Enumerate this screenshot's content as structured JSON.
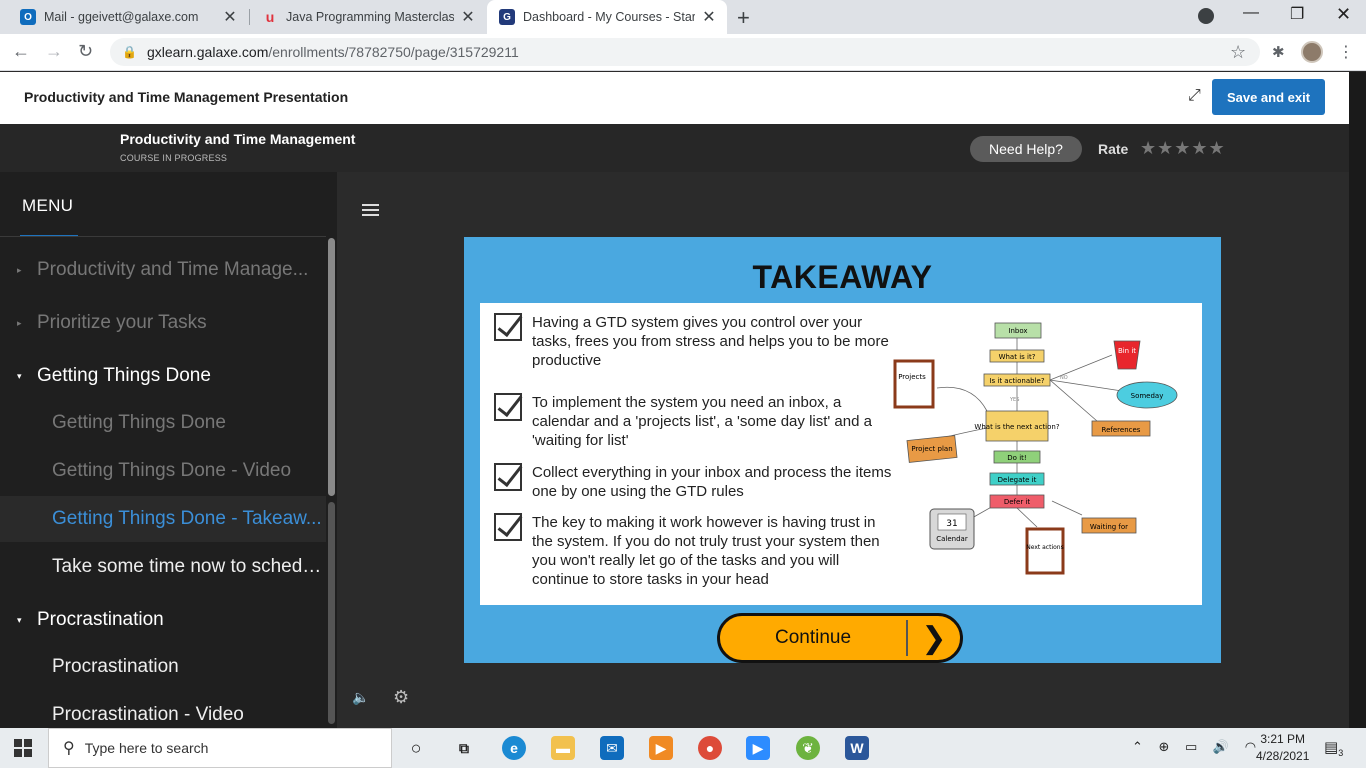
{
  "browser": {
    "tabs": [
      {
        "title": "Mail - ggeivett@galaxe.com",
        "icon": "outlook-icon",
        "icon_color": "#0f6cbd",
        "active": false
      },
      {
        "title": "Java Programming Masterclass fo",
        "icon": "udemy-icon",
        "icon_color": "#e0323d",
        "active": false
      },
      {
        "title": "Dashboard - My Courses - Start C",
        "icon": "galaxe-icon",
        "icon_color": "#223a7a",
        "active": true
      }
    ],
    "url_host": "gxlearn.galaxe.com",
    "url_path": "/enrollments/78782750/page/315729211"
  },
  "course_top": {
    "title": "Productivity and Time Management Presentation",
    "save_label": "Save and exit"
  },
  "banner": {
    "course_title": "Productivity and Time Management",
    "status": "COURSE IN PROGRESS",
    "help_label": "Need Help?",
    "rate_label": "Rate",
    "rating": 0,
    "stars": "★★★★★"
  },
  "sidebar": {
    "menu_label": "MENU",
    "items": [
      {
        "label": "Productivity and Time Manage...",
        "level": 0,
        "expanded": false,
        "dim": true
      },
      {
        "label": "Prioritize your Tasks",
        "level": 0,
        "expanded": false,
        "dim": true
      },
      {
        "label": "Getting Things Done",
        "level": 0,
        "expanded": true,
        "dim": false
      },
      {
        "label": "Getting Things Done",
        "level": 1,
        "dim": true
      },
      {
        "label": "Getting Things Done - Video",
        "level": 1,
        "dim": true
      },
      {
        "label": "Getting Things Done - Takeaw...",
        "level": 1,
        "active": true
      },
      {
        "label": "Take some time now to schedu...",
        "level": 1,
        "dim": false
      },
      {
        "label": "Procrastination",
        "level": 0,
        "expanded": true,
        "dim": false
      },
      {
        "label": "Procrastination",
        "level": 1,
        "dim": false
      },
      {
        "label": "Procrastination - Video",
        "level": 1,
        "dim": false
      }
    ]
  },
  "slide": {
    "title": "TAKEAWAY",
    "points": [
      "Having a GTD system gives you control over your tasks, frees you from stress and helps you to be more productive",
      "To implement the system you need an inbox, a calendar and a 'projects list', a 'some day list' and a 'waiting for list'",
      "Collect everything in your inbox and process the items one by one using the GTD rules",
      "The key to making it work however is having trust in the system. If you do not truly trust your system then you won't really let go of the tasks and you will continue to store tasks in your head"
    ],
    "diagram": {
      "inbox": "Inbox",
      "what": "What is it?",
      "actionable": "Is it actionable?",
      "no": "NO",
      "yes": "YES",
      "bin": "Bin it",
      "someday": "Someday",
      "references": "References",
      "projects": "Projects",
      "project_plan": "Project plan",
      "next_action": "What is the next action?",
      "do": "Do it!",
      "delegate": "Delegate it",
      "defer": "Defer it",
      "waiting": "Waiting for",
      "calendar_num": "31",
      "calendar": "Calendar",
      "next_actions": "Next actions"
    },
    "continue_label": "Continue"
  },
  "taskbar": {
    "search_placeholder": "Type here to search",
    "time": "3:21 PM",
    "date": "4/28/2021",
    "notifications": "3"
  }
}
